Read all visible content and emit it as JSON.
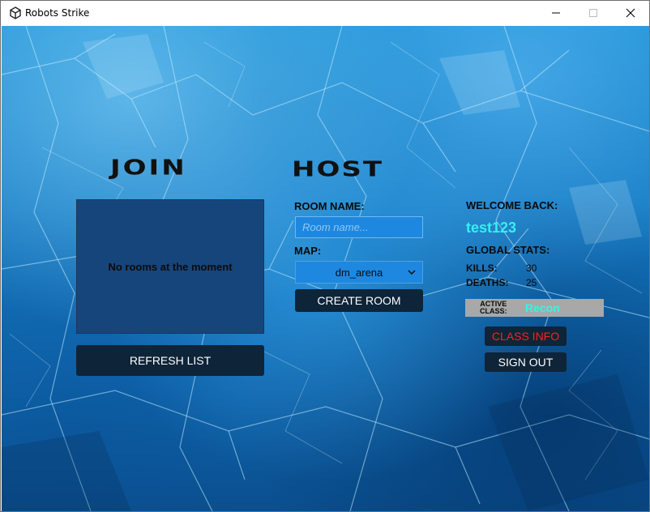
{
  "window": {
    "title": "Robots Strike"
  },
  "join": {
    "heading": "JOIN",
    "empty_message": "No rooms at the moment",
    "refresh_label": "REFRESH LIST"
  },
  "host": {
    "heading": "HOST",
    "room_name_label": "ROOM NAME:",
    "room_name_placeholder": "Room name...",
    "map_label": "MAP:",
    "map_selected": "dm_arena",
    "create_label": "CREATE ROOM"
  },
  "profile": {
    "welcome_label": "WELCOME BACK:",
    "username": "test123",
    "global_stats_label": "GLOBAL STATS:",
    "kills_label": "KILLS:",
    "kills_value": "30",
    "deaths_label": "DEATHS:",
    "deaths_value": "25",
    "active_class_label": "ACTIVE CLASS:",
    "active_class_value": "Recon",
    "class_info_label": "CLASS INFO",
    "sign_out_label": "SIGN OUT"
  },
  "colors": {
    "username": "#33f0f2",
    "class_info_text": "#ff1f1f",
    "button_bg": "#0e2438",
    "rooms_panel": "#16457c"
  }
}
